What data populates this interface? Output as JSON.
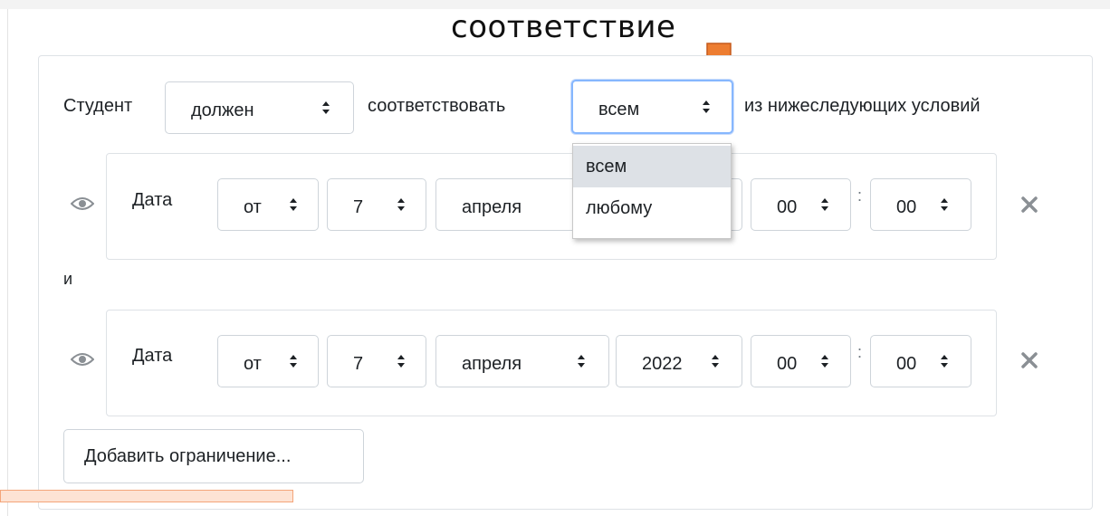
{
  "caption": "соответствие",
  "colors": {
    "accent": "#ed7d31",
    "focus": "#86b7fe",
    "selected_option_bg": "#dde1e6"
  },
  "header_row": {
    "label_student": "Студент",
    "must_select": "должен",
    "label_match": "соответствовать",
    "match_select": "всем",
    "label_conditions": "из нижеследующих условий"
  },
  "dropdown": {
    "options": [
      "всем",
      "любому"
    ],
    "selected": "всем"
  },
  "conditions": [
    {
      "type_label": "Дата",
      "direction": "от",
      "day": "7",
      "month": "апреля",
      "year": "",
      "hour": "00",
      "minute": "00",
      "hour_minute_separator": ":"
    },
    {
      "type_label": "Дата",
      "direction": "от",
      "day": "7",
      "month": "апреля",
      "year": "2022",
      "hour": "00",
      "minute": "00",
      "hour_minute_separator": ":"
    }
  ],
  "connector": "и",
  "add_button_label": "Добавить ограничение..."
}
